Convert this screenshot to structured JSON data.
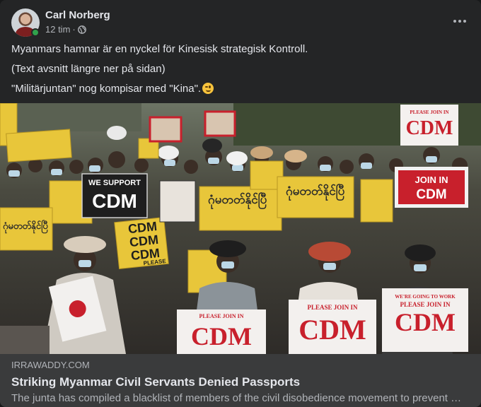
{
  "post": {
    "author": "Carl Norberg",
    "time": "12 tim",
    "separator": "·",
    "privacy_icon": "globe-icon",
    "more_icon": "more-horizontal-icon",
    "text_lines": [
      "Myanmars hamnar är en nyckel för Kinesisk strategisk Kontroll.",
      "(Text avsnitt längre ner på sidan)",
      "\"Militärjuntan\" nog kompisar med \"Kina\"."
    ],
    "emoji": "winking-face-emoji"
  },
  "photo": {
    "signs": {
      "we_support_line1": "WE SUPPORT",
      "we_support_line2": "CDM",
      "cdm_stack": [
        "CDM",
        "CDM",
        "CDM"
      ],
      "cdm_stack_footer": "PLEASE",
      "join_line1": "JOIN IN",
      "join_line2": "CDM",
      "please_join": "PLEASE JOIN IN",
      "cdm": "CDM",
      "going_to_work": "WE'RE GOING TO WORK",
      "burmese": "ဂုံမတတ်နိုင်ပြီ"
    }
  },
  "link": {
    "domain": "IRRAWADDY.COM",
    "title": "Striking Myanmar Civil Servants Denied Passports",
    "description": "The junta has compiled a blacklist of members of the civil disobedience movement to prevent …"
  },
  "colors": {
    "card_bg": "#242526",
    "link_bg": "#3a3b3c",
    "sign_yellow": "#e8c63a",
    "sign_red": "#c8202c",
    "online_green": "#31a24c"
  }
}
